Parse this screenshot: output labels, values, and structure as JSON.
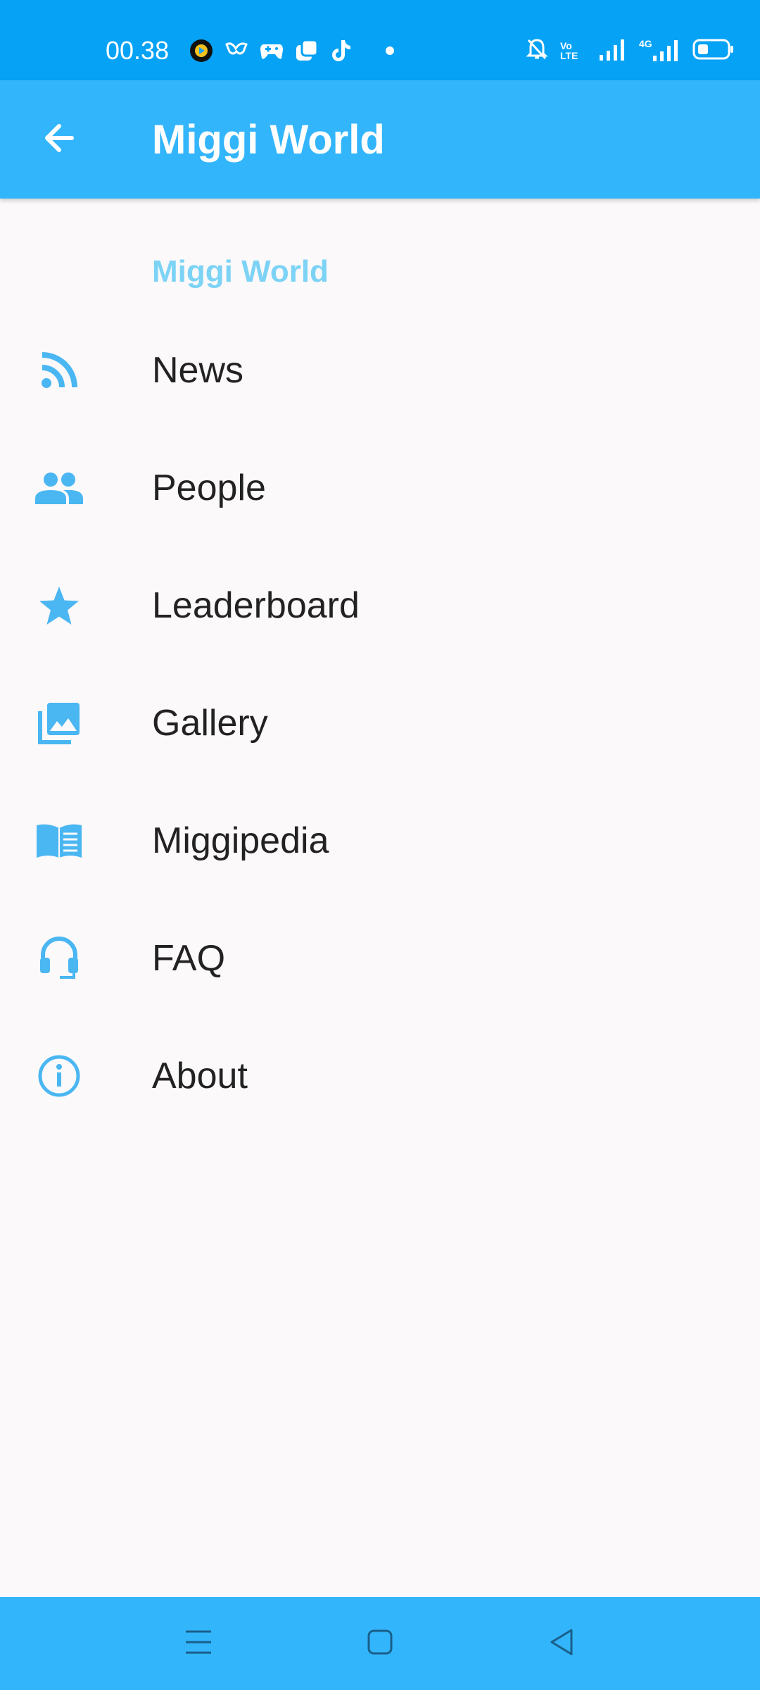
{
  "status_bar": {
    "time": "00.38",
    "network_label": "4G",
    "volte_label_top": "Vo",
    "volte_label_bottom": "LTE",
    "icons": [
      "music-app-icon",
      "butterfly-app-icon",
      "gamepad-icon",
      "copy-app-icon",
      "tiktok-icon",
      "notification-dot",
      "mute-bell-icon",
      "volte-icon",
      "signal-icon",
      "signal-4g-icon",
      "battery-icon"
    ]
  },
  "app_bar": {
    "title": "Miggi World",
    "back_icon": "arrow-left-icon"
  },
  "drawer": {
    "section_title": "Miggi World",
    "items": [
      {
        "label": "News",
        "icon": "rss-icon"
      },
      {
        "label": "People",
        "icon": "people-icon"
      },
      {
        "label": "Leaderboard",
        "icon": "star-icon"
      },
      {
        "label": "Gallery",
        "icon": "photo-library-icon"
      },
      {
        "label": "Miggipedia",
        "icon": "book-icon"
      },
      {
        "label": "FAQ",
        "icon": "headset-icon"
      },
      {
        "label": "About",
        "icon": "info-icon"
      }
    ]
  },
  "nav_bar": {
    "buttons": [
      "menu-icon",
      "home-square-icon",
      "back-triangle-icon"
    ]
  },
  "colors": {
    "status_bar": "#05a2f5",
    "app_bar": "#33b5fb",
    "icon": "#4ab6f2",
    "section_title": "#7cd3f5",
    "background": "#fcf9fa",
    "text": "#222222"
  }
}
